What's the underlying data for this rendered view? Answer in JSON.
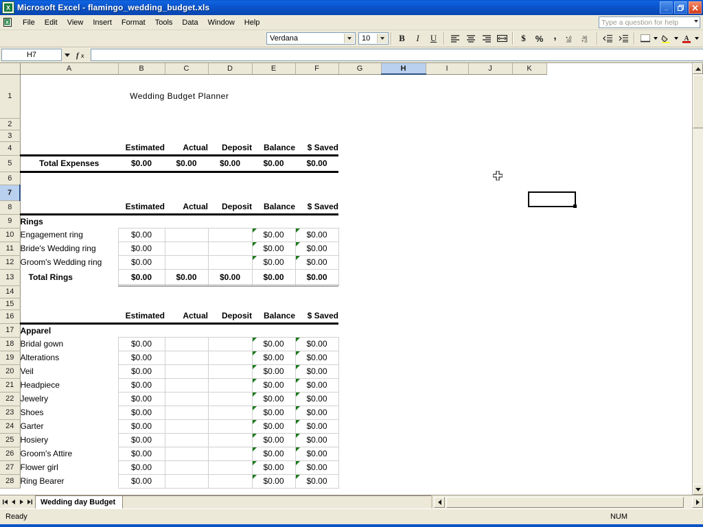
{
  "window": {
    "title": "Microsoft Excel - flamingo_wedding_budget.xls",
    "minimize": "_",
    "restore": "❐",
    "close": "×"
  },
  "menu": {
    "items": [
      "File",
      "Edit",
      "View",
      "Insert",
      "Format",
      "Tools",
      "Data",
      "Window",
      "Help"
    ]
  },
  "help": {
    "placeholder": "Type a question for help"
  },
  "toolbar": {
    "font_name": "Verdana",
    "font_size": "10",
    "bold": "B",
    "italic": "I",
    "underline": "U",
    "align_left": "align-left",
    "align_center": "align-center",
    "align_right": "align-right",
    "merge_center": "merge-and-center",
    "currency": "$",
    "percent": "%",
    "comma": ",",
    "increase_decimal": "increase-decimal",
    "decrease_decimal": "decrease-decimal",
    "decrease_indent": "decrease-indent",
    "increase_indent": "increase-indent",
    "borders": "borders",
    "fill_color": "fill-color",
    "font_color": "font-color"
  },
  "formula_bar": {
    "name_box": "H7",
    "fx": "fx",
    "formula": ""
  },
  "grid": {
    "columns": [
      "A",
      "B",
      "C",
      "D",
      "E",
      "F",
      "G",
      "H",
      "I",
      "J",
      "K"
    ],
    "selected_column": "H",
    "selected_row": 7,
    "selected_cell": "H7",
    "row_numbers": [
      1,
      2,
      3,
      4,
      5,
      6,
      7,
      8,
      9,
      10,
      11,
      12,
      13,
      14,
      15,
      16,
      17,
      18,
      19,
      20,
      21,
      22,
      23,
      24,
      25,
      26,
      27,
      28
    ]
  },
  "sheet": {
    "title_banner": "Wedding Budget Planner",
    "column_headers": [
      "Estimated",
      "Actual",
      "Deposit",
      "Balance",
      "$ Saved"
    ],
    "total_expenses": {
      "label": "Total Expenses",
      "values": [
        "$0.00",
        "$0.00",
        "$0.00",
        "$0.00",
        "$0.00"
      ]
    },
    "sections": [
      {
        "name": "Rings",
        "header_row": 9,
        "items": [
          {
            "row": 10,
            "name": "Engagement ring",
            "estimated": "$0.00",
            "actual": "",
            "deposit": "",
            "balance": "$0.00",
            "saved": "$0.00"
          },
          {
            "row": 11,
            "name": "Bride's Wedding ring",
            "estimated": "$0.00",
            "actual": "",
            "deposit": "",
            "balance": "$0.00",
            "saved": "$0.00"
          },
          {
            "row": 12,
            "name": "Groom's Wedding ring",
            "estimated": "$0.00",
            "actual": "",
            "deposit": "",
            "balance": "$0.00",
            "saved": "$0.00"
          }
        ],
        "total": {
          "row": 13,
          "label": "Total Rings",
          "values": [
            "$0.00",
            "$0.00",
            "$0.00",
            "$0.00",
            "$0.00"
          ]
        }
      },
      {
        "name": "Apparel",
        "header_row": 17,
        "items": [
          {
            "row": 18,
            "name": "Bridal gown",
            "estimated": "$0.00",
            "actual": "",
            "deposit": "",
            "balance": "$0.00",
            "saved": "$0.00"
          },
          {
            "row": 19,
            "name": "Alterations",
            "estimated": "$0.00",
            "actual": "",
            "deposit": "",
            "balance": "$0.00",
            "saved": "$0.00"
          },
          {
            "row": 20,
            "name": "Veil",
            "estimated": "$0.00",
            "actual": "",
            "deposit": "",
            "balance": "$0.00",
            "saved": "$0.00"
          },
          {
            "row": 21,
            "name": "Headpiece",
            "estimated": "$0.00",
            "actual": "",
            "deposit": "",
            "balance": "$0.00",
            "saved": "$0.00"
          },
          {
            "row": 22,
            "name": "Jewelry",
            "estimated": "$0.00",
            "actual": "",
            "deposit": "",
            "balance": "$0.00",
            "saved": "$0.00"
          },
          {
            "row": 23,
            "name": "Shoes",
            "estimated": "$0.00",
            "actual": "",
            "deposit": "",
            "balance": "$0.00",
            "saved": "$0.00"
          },
          {
            "row": 24,
            "name": "Garter",
            "estimated": "$0.00",
            "actual": "",
            "deposit": "",
            "balance": "$0.00",
            "saved": "$0.00"
          },
          {
            "row": 25,
            "name": "Hosiery",
            "estimated": "$0.00",
            "actual": "",
            "deposit": "",
            "balance": "$0.00",
            "saved": "$0.00"
          },
          {
            "row": 26,
            "name": "Groom's Attire",
            "estimated": "$0.00",
            "actual": "",
            "deposit": "",
            "balance": "$0.00",
            "saved": "$0.00"
          },
          {
            "row": 27,
            "name": "Flower girl",
            "estimated": "$0.00",
            "actual": "",
            "deposit": "",
            "balance": "$0.00",
            "saved": "$0.00"
          },
          {
            "row": 28,
            "name": "Ring Bearer",
            "estimated": "$0.00",
            "actual": "",
            "deposit": "",
            "balance": "$0.00",
            "saved": "$0.00"
          }
        ]
      }
    ]
  },
  "tabs": {
    "active": "Wedding day Budget",
    "nav_first": "first-sheet",
    "nav_prev": "previous-sheet",
    "nav_next": "next-sheet",
    "nav_last": "last-sheet"
  },
  "status": {
    "message": "Ready",
    "num_lock": "NUM"
  },
  "colors": {
    "title_banner_bg": "#CC8099",
    "total_expenses_bg": "#FBCC96",
    "section_header_bg": "#FFFF99",
    "titlebar_bg": "#0A54C8",
    "selected_header_bg": "#B9D0EF",
    "error_triangle": "#1A7A1A"
  }
}
